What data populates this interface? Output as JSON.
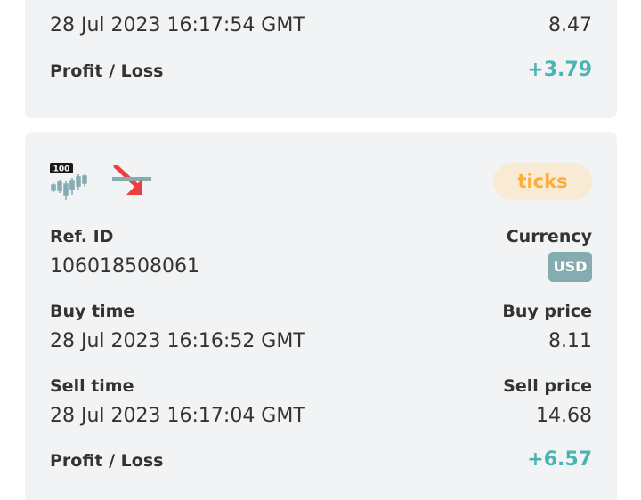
{
  "colors": {
    "profit": "#4bb4b3",
    "loss": "#ec3f3f",
    "tag_bg": "#f8ead3",
    "tag_text": "#ffad3a",
    "currency_bg": "#85acb0",
    "card_bg": "#f2f3f4"
  },
  "previous_contract": {
    "sell_time_value": "28 Jul 2023 16:17:54 GMT",
    "sell_price_value": "8.47",
    "profit_loss_label": "Profit / Loss",
    "profit_loss_value": "+3.79"
  },
  "contract": {
    "market_icon": "volatility-100-index-icon",
    "market_icon_badge": "100",
    "trade_type_icon": "fall-arrow-icon",
    "duration_tag": "ticks",
    "ref_id_label": "Ref. ID",
    "ref_id_value": "106018508061",
    "currency_label": "Currency",
    "currency_value": "USD",
    "buy_time_label": "Buy time",
    "buy_time_value": "28 Jul 2023 16:16:52 GMT",
    "buy_price_label": "Buy price",
    "buy_price_value": "8.11",
    "sell_time_label": "Sell time",
    "sell_time_value": "28 Jul 2023 16:17:04 GMT",
    "sell_price_label": "Sell price",
    "sell_price_value": "14.68",
    "profit_loss_label": "Profit / Loss",
    "profit_loss_value": "+6.57"
  }
}
